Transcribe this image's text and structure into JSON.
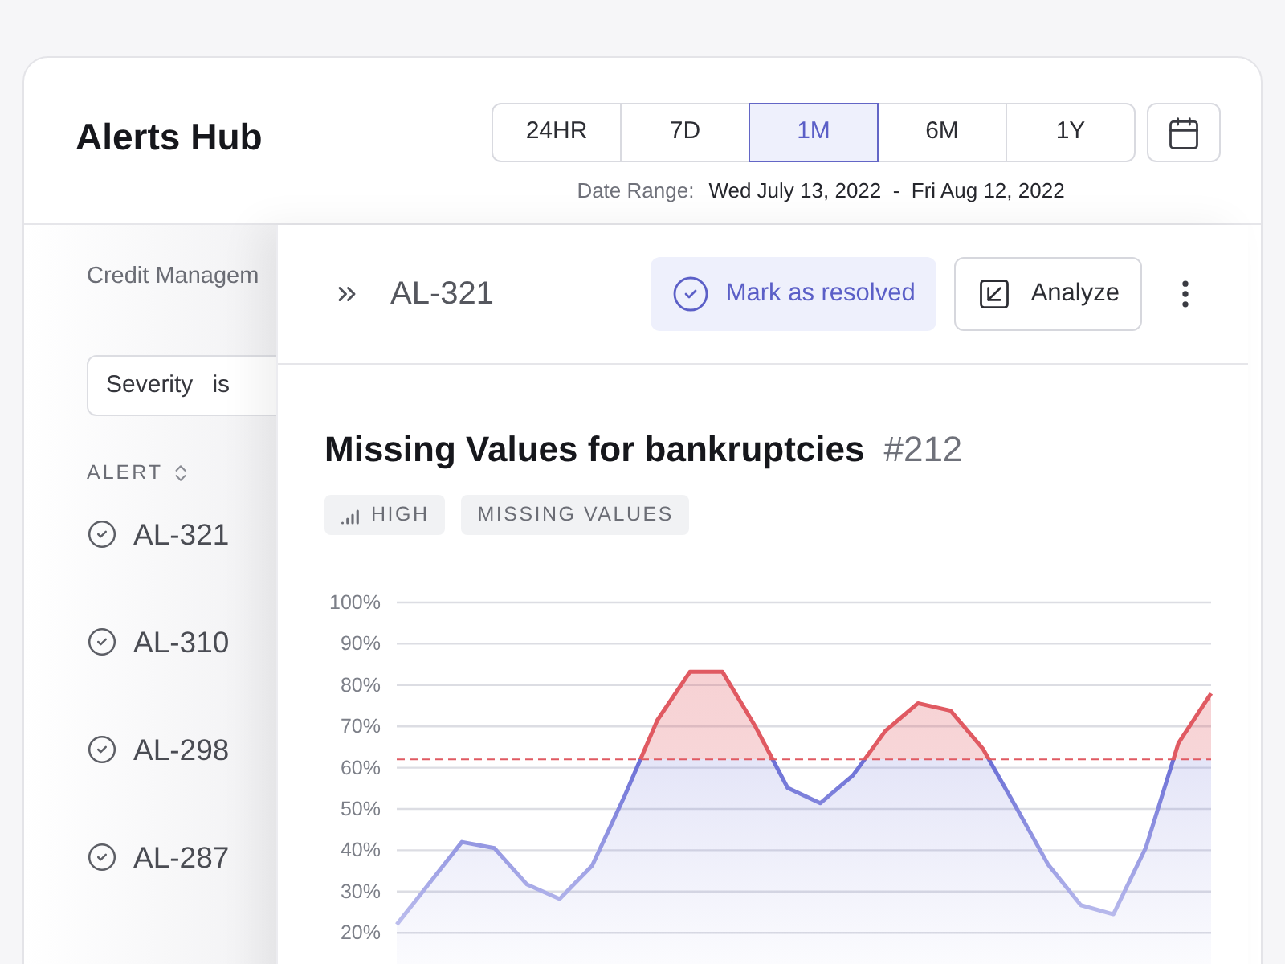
{
  "header": {
    "title": "Alerts Hub",
    "ranges": [
      {
        "label": "24HR",
        "selected": false
      },
      {
        "label": "7D",
        "selected": false
      },
      {
        "label": "1M",
        "selected": true
      },
      {
        "label": "6M",
        "selected": false
      },
      {
        "label": "1Y",
        "selected": false
      }
    ],
    "date_range_label": "Date Range:",
    "date_range": "Wed July 13, 2022  -  Fri Aug 12, 2022"
  },
  "sidebar": {
    "breadcrumb": "Credit Managem",
    "filter": {
      "field": "Severity",
      "operator": "is"
    },
    "column_header": "ALERT",
    "alerts": [
      "AL-321",
      "AL-310",
      "AL-298",
      "AL-287"
    ]
  },
  "detail": {
    "alert_id": "AL-321",
    "resolve_button": "Mark as resolved",
    "analyze_button": "Analyze",
    "title": "Missing Values for bankruptcies",
    "number": "#212",
    "tags": [
      {
        "kind": "severity",
        "label": "HIGH"
      },
      {
        "kind": "category",
        "label": "MISSING VALUES"
      }
    ],
    "chart_data": {
      "type": "area",
      "categories": [
        null,
        null,
        null,
        null,
        null,
        null,
        null,
        null,
        null,
        null,
        null,
        null,
        null,
        null,
        null,
        null,
        null,
        null,
        null,
        null,
        null,
        null,
        null,
        null,
        null,
        null
      ],
      "series": [
        {
          "color": "#6b6fd6",
          "values": [
            22,
            32,
            42,
            40.5,
            31.7,
            28.2,
            36.3,
            53.2,
            71.5,
            83.2,
            83.2,
            70.1,
            55.1,
            51.4,
            58.1,
            68.9,
            75.6,
            73.8,
            64.5,
            50.6,
            36.5,
            26.7,
            24.5,
            40.7,
            66,
            78
          ]
        }
      ],
      "ylim": [
        20,
        100
      ],
      "yticks": [
        {
          "value": 100,
          "label": "100%"
        },
        {
          "value": 90,
          "label": "90%"
        },
        {
          "value": 80,
          "label": "80%"
        },
        {
          "value": 70,
          "label": "70%"
        },
        {
          "value": 60,
          "label": "60%"
        },
        {
          "value": 50,
          "label": "50%"
        },
        {
          "value": 40,
          "label": "40%"
        },
        {
          "value": 30,
          "label": "30%"
        },
        {
          "value": 20,
          "label": "20%"
        }
      ],
      "grid": true,
      "ref_lines": [
        {
          "axis": "y",
          "value": 62,
          "color": "#e05a62"
        }
      ]
    }
  }
}
